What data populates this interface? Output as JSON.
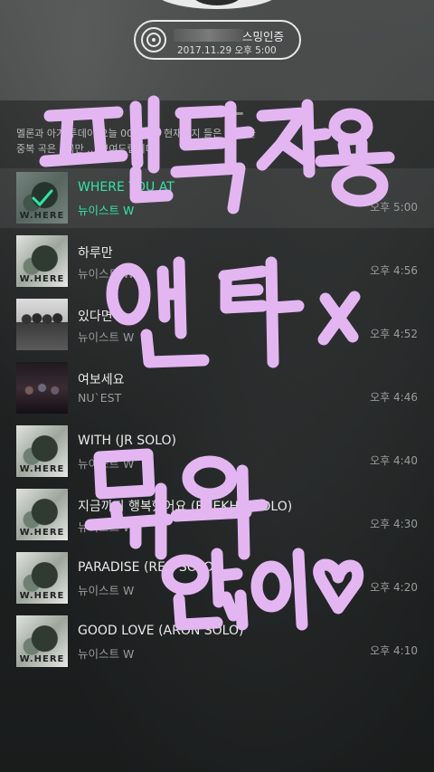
{
  "badge": {
    "title": "스밍인증",
    "timestamp": "2017.11.29 오후 5:00"
  },
  "notice": {
    "line1": "멜론과 아거 투데이 오늘 00시부터 현재까지 들은 10곡을",
    "line2": "중복 곡은 1곡만 ... 보여드립니다."
  },
  "tracks": [
    {
      "title": "WHERE YOU AT",
      "artist": "뉴이스트 W",
      "time": "오후 5:00",
      "current": true,
      "art": "where"
    },
    {
      "title": "하루만",
      "artist": "뉴이스트 W",
      "time": "오후 4:56",
      "current": false,
      "art": "where"
    },
    {
      "title": "있다면",
      "artist": "뉴이스트 W",
      "time": "오후 4:52",
      "current": false,
      "art": "group"
    },
    {
      "title": "여보세요",
      "artist": "NU`EST",
      "time": "오후 4:46",
      "current": false,
      "art": "dark"
    },
    {
      "title": "WITH (JR SOLO)",
      "artist": "뉴이스트 W",
      "time": "오후 4:40",
      "current": false,
      "art": "where"
    },
    {
      "title": "지금까지 행복했어요 (BAEKHO SOLO)",
      "artist": "뉴이스트 W",
      "time": "오후 4:30",
      "current": false,
      "art": "where"
    },
    {
      "title": "PARADISE (REN SOLO)",
      "artist": "뉴이스트 W",
      "time": "오후 4:20",
      "current": false,
      "art": "where"
    },
    {
      "title": "GOOD LOVE (ARON SOLO)",
      "artist": "뉴이스트 W",
      "time": "오후 4:10",
      "current": false,
      "art": "where"
    }
  ],
  "album_label": "W.HERE",
  "overlay": {
    "line1": "팬덕 전용",
    "line2": "엔터 X",
    "line3": "뭐와",
    "line4": "않이♡",
    "color": "#e3b6f2"
  },
  "accent_color": "#33e3a8"
}
